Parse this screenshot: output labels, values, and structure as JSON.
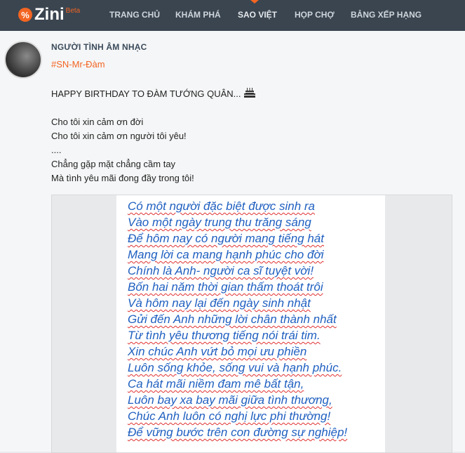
{
  "logo": {
    "text": "Zini",
    "sup": "Beta"
  },
  "nav": [
    "TRANG CHỦ",
    "KHÁM PHÁ",
    "SAO VIỆT",
    "HỌP CHỢ",
    "BẢNG XẾP HẠNG"
  ],
  "post": {
    "author": "NGƯỜI TÌNH ÂM NHẠC",
    "hashtag": "#SN-Mr-Đàm",
    "lines": [
      "HAPPY BIRTHDAY TO ĐÀM TƯỚNG QUÂN...",
      "",
      "Cho tôi xin cảm ơn đời",
      "Cho tôi xin cảm ơn người tôi yêu!",
      "....",
      "Chẳng gặp mặt chẳng cầm tay",
      "Mà tình yêu mãi đong đầy trong tôi!"
    ],
    "emoji": "cake-icon"
  },
  "poem": [
    "Có một người đặc biệt được sinh ra",
    "Vào một ngày trung thu trăng sáng",
    "Để hôm nay có người mang tiếng hát",
    "Mang lời ca mang hạnh phúc cho đời",
    "Chính là Anh- người ca sĩ tuyệt vời!",
    " Bốn hai năm thời gian thấm thoát trôi",
    "Và hôm nay lại đến ngày sinh nhật",
    " Gửi đến Anh những lời chân thành nhất",
    " Từ tình yêu thương tiếng nói trái tim.",
    "Xin chúc Anh vứt bỏ mọi ưu phiền",
    "Luôn sống khỏe, sống vui và hạnh phúc.",
    "Ca hát mãi niềm đam mê bất tận,",
    "Luôn bay xa bay mãi giữa tình thương,",
    "Chúc Anh luôn có nghị lực phi thường!",
    "Để vững bước trên con đường sự nghiệp!"
  ]
}
